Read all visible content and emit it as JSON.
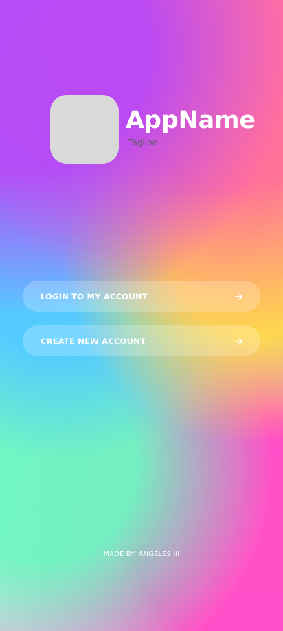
{
  "header": {
    "app_name": "AppName",
    "tagline": "Tagline"
  },
  "actions": [
    {
      "label": "LOGIN TO MY ACCOUNT",
      "icon": "arrow-right-icon"
    },
    {
      "label": "CREATE NEW ACCOUNT",
      "icon": "arrow-right-icon"
    }
  ],
  "footer": {
    "credit": "MADE BY: ANGELES III"
  },
  "colors": {
    "app_name": "#ffffff",
    "tagline": "#5d5d66",
    "logo_placeholder": "#d9d9d9",
    "button_text": "#ffffff"
  }
}
